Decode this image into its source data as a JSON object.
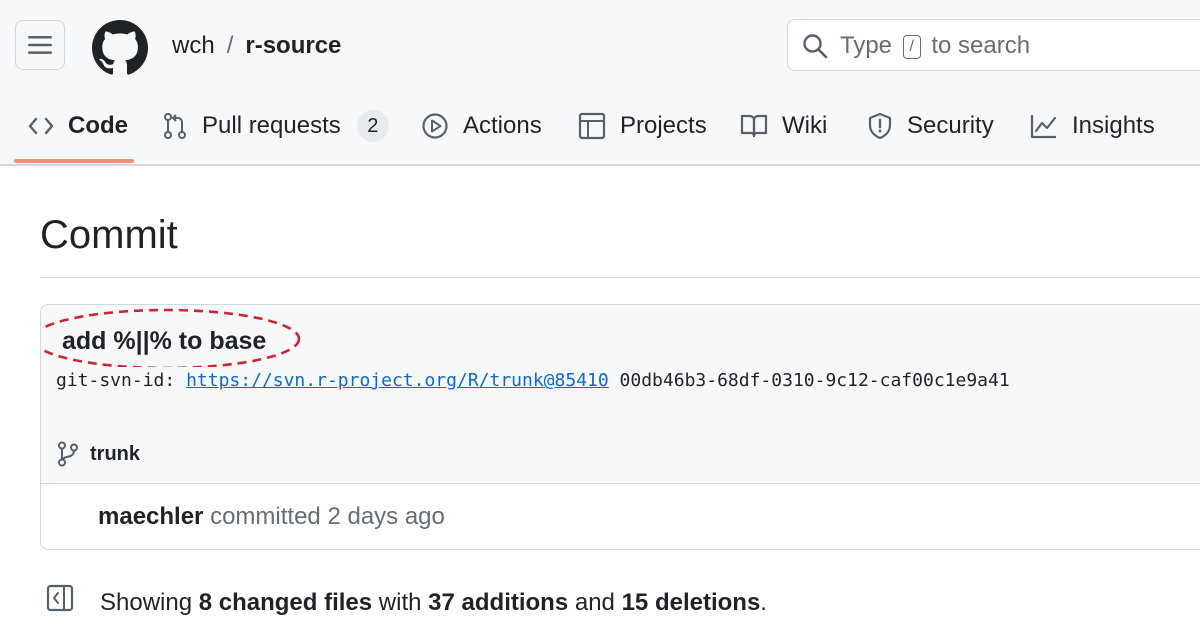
{
  "header": {
    "owner": "wch",
    "separator": "/",
    "repo": "r-source",
    "search": {
      "prefix": "Type",
      "key": "/",
      "suffix": "to search"
    }
  },
  "tabs": [
    {
      "label": "Code",
      "icon": "code-icon",
      "active": true
    },
    {
      "label": "Pull requests",
      "icon": "pull-request-icon",
      "counter": "2"
    },
    {
      "label": "Actions",
      "icon": "play-icon"
    },
    {
      "label": "Projects",
      "icon": "table-icon"
    },
    {
      "label": "Wiki",
      "icon": "book-icon"
    },
    {
      "label": "Security",
      "icon": "shield-icon"
    },
    {
      "label": "Insights",
      "icon": "graph-icon"
    }
  ],
  "page": {
    "title": "Commit"
  },
  "commit": {
    "message": "add %||% to base",
    "svn_label": "git-svn-id:",
    "svn_link": "https://svn.r-project.org/R/trunk@85410",
    "svn_hash": "00db46b3-68df-0310-9c12-caf00c1e9a41",
    "branch": "trunk",
    "author": "maechler",
    "action": "committed",
    "time": "2 days ago"
  },
  "summary": {
    "showing": "Showing",
    "files": "8 changed files",
    "with": "with",
    "additions": "37 additions",
    "and": "and",
    "deletions": "15 deletions",
    "end": "."
  },
  "colors": {
    "accent_underline": "#fd8c73",
    "link": "#0969da",
    "annotation": "#d1242f"
  }
}
